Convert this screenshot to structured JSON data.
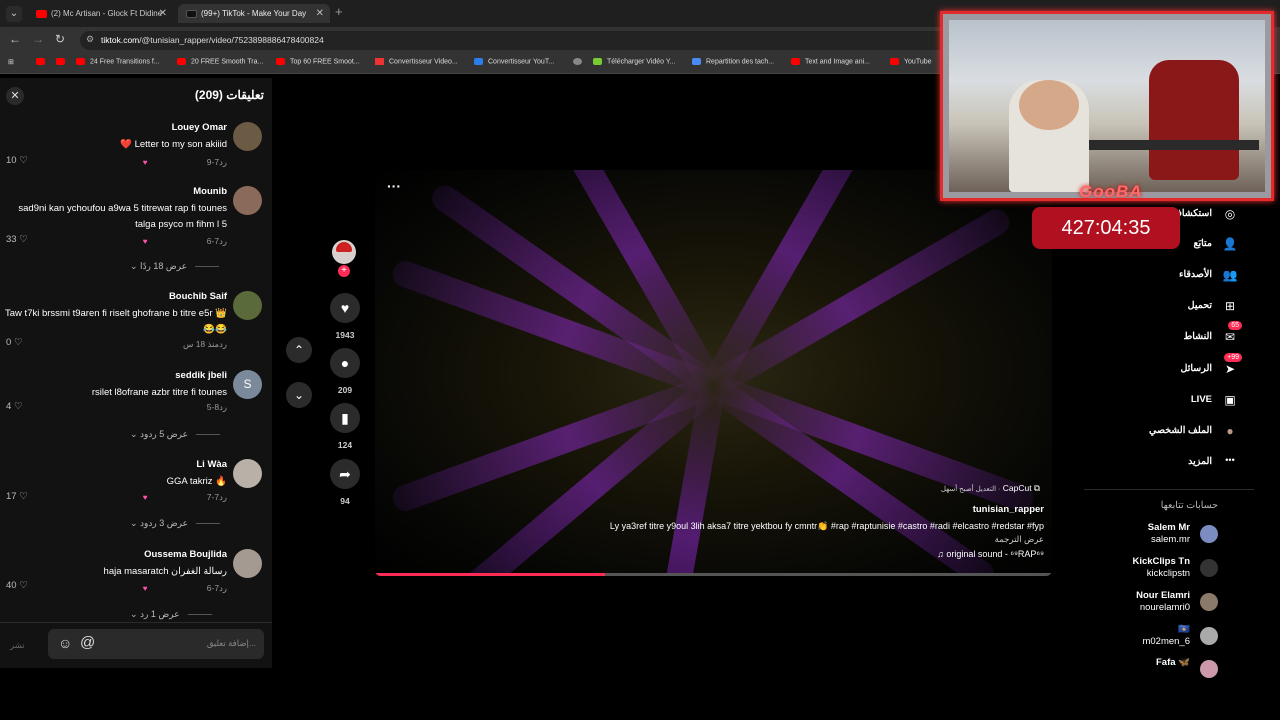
{
  "browser": {
    "tabs": [
      {
        "title": "(2) Mc Artisan - Glock Ft Didine",
        "active": false
      },
      {
        "title": "(99+) TikTok - Make Your Day",
        "active": true
      }
    ],
    "url_host": "tiktok.com",
    "url_path": "/@tunisian_rapper/video/7523898886478400824",
    "bookmarks": [
      "24 Free Transitions f...",
      "20 FREE Smooth Tra...",
      "Top 60 FREE Smoot...",
      "Convertisseur Video...",
      "Convertisseur YouT...",
      "Télécharger Vidéo Y...",
      "Repartition des tach...",
      "Text and Image ani...",
      "YouTube"
    ]
  },
  "comments": {
    "title": "تعليقات (209)",
    "close_glyph": "✕",
    "items": [
      {
        "name": "Louey Omar",
        "text": "❤️ Letter to my son akiiid",
        "date": "7-9",
        "reply": "رد",
        "likes": "10"
      },
      {
        "name": "Mounib",
        "text": "sad9ni kan ychoufou a9wa 5 titrewat rap fi tounes talga psyco m fihm l 5",
        "date": "7-6",
        "reply": "رد",
        "likes": "33"
      },
      {
        "name": "Bouchib Saif",
        "text": "Taw t7ki brssmi t9aren fi riselt ghofrane b titre e5r 👑😂😂",
        "date": "منذ 18 س",
        "reply": "رد",
        "likes": "0"
      },
      {
        "name": "seddik jbeli",
        "text": "rsilet l8ofrane azbr titre fi tounes",
        "date": "8-5",
        "reply": "رد",
        "likes": "4"
      },
      {
        "name": "Li Wàa",
        "text": "GGA takriz 🔥",
        "date": "7-7",
        "reply": "رد",
        "likes": "17"
      },
      {
        "name": "Oussema Boujlida",
        "text": "haja masaratch رسالة الغفران",
        "date": "7-6",
        "reply": "رد",
        "likes": "40"
      }
    ],
    "more_replies": [
      "عرض 18 ردًا",
      "عرض 5 ردود",
      "عرض 3 ردود",
      "عرض 1 رد"
    ],
    "input_placeholder": "إضافة تعليق...",
    "post_label": "نشر"
  },
  "video": {
    "capcut_label": "CapCut",
    "capcut_sub": "التعديل أصبح أسهل ·",
    "username": "tunisian_rapper",
    "caption": "Ly ya3ref titre y9oul 3lih aksa7 titre yektbou fy cmntr👏 #rap #raptunisie #castro #radi #elcastro #redstar #fyp",
    "translate": "عرض الترجمة",
    "sound": "♫ original sound - ⁶⁹RAP⁶⁹",
    "progress": 0.34
  },
  "actions": {
    "likes": "1943",
    "comments": "209",
    "saves": "124",
    "shares": "94"
  },
  "sidebar": {
    "items": [
      {
        "label": "استكشاف",
        "icon": "compass-icon",
        "glyph": "◎"
      },
      {
        "label": "متابَع",
        "icon": "following-icon",
        "glyph": "👤"
      },
      {
        "label": "الأصدقاء",
        "icon": "friends-icon",
        "glyph": "👥"
      },
      {
        "label": "تحميل",
        "icon": "upload-icon",
        "glyph": "⊞"
      },
      {
        "label": "النشاط",
        "icon": "activity-icon",
        "glyph": "✉",
        "badge": "65"
      },
      {
        "label": "الرسائل",
        "icon": "messages-icon",
        "glyph": "➤",
        "badge": "+99"
      },
      {
        "label": "LIVE",
        "icon": "live-icon",
        "glyph": "▣"
      },
      {
        "label": "الملف الشخصي",
        "icon": "profile-icon",
        "glyph": "●"
      },
      {
        "label": "المزيد",
        "icon": "more-icon",
        "glyph": "•••"
      }
    ],
    "following_title": "حسابات تتابعها",
    "following": [
      {
        "name": "Salem Mr",
        "handle": "salem.mr"
      },
      {
        "name": "KickClips Tn",
        "handle": "kickclipstn"
      },
      {
        "name": "Nour Elamri",
        "handle": "nourelamri0"
      },
      {
        "name": "🇽🇰",
        "handle": "m02men_6"
      },
      {
        "name": "Fafa 🦋",
        "handle": ""
      }
    ]
  },
  "overlay": {
    "streamer_tag": "GooBA",
    "timer": "427:04:35"
  },
  "colors": {
    "accent": "#fe2c55",
    "frame": "#e32b2b",
    "timer_bg": "#b01020"
  }
}
